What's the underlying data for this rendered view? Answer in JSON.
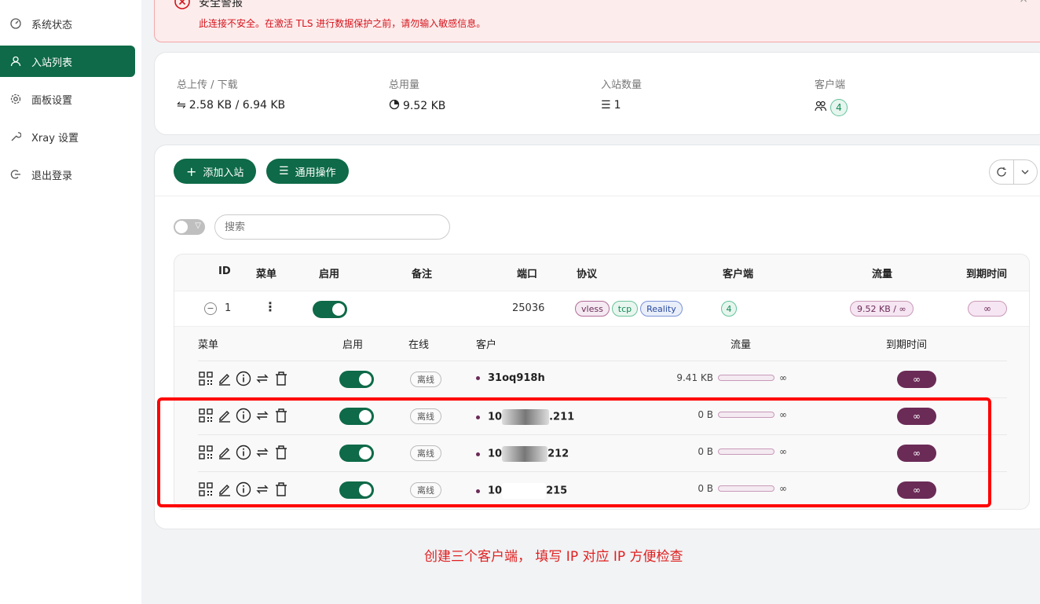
{
  "sidebar": {
    "items": [
      {
        "label": "系统状态",
        "icon": "dashboard-icon"
      },
      {
        "label": "入站列表",
        "icon": "user-icon",
        "active": true
      },
      {
        "label": "面板设置",
        "icon": "gear-icon"
      },
      {
        "label": "Xray 设置",
        "icon": "wrench-icon"
      },
      {
        "label": "退出登录",
        "icon": "logout-icon"
      }
    ]
  },
  "alert": {
    "title": "安全警报",
    "message": "此连接不安全。在激活 TLS 进行数据保护之前，请勿输入敏感信息。",
    "close": "×"
  },
  "stats": {
    "upload_download": {
      "label": "总上传 / 下载",
      "value": "2.58 KB / 6.94 KB",
      "symbol": "⇋"
    },
    "total_usage": {
      "label": "总用量",
      "value": "9.52 KB"
    },
    "inbound_count": {
      "label": "入站数量",
      "value": "1",
      "symbol": "☰"
    },
    "clients": {
      "label": "客户端",
      "value": "4"
    }
  },
  "toolbar": {
    "add_inbound": "添加入站",
    "general_actions": "通用操作",
    "search_placeholder": "搜索"
  },
  "table": {
    "headers": {
      "id": "ID",
      "menu": "菜单",
      "enabled": "启用",
      "remark": "备注",
      "port": "端口",
      "protocol": "协议",
      "clients": "客户端",
      "traffic": "流量",
      "expiry": "到期时间"
    },
    "inbound": {
      "collapse": "−",
      "id": "1",
      "menu": "⋮",
      "remark": "",
      "port": "25036",
      "protocols": [
        "vless",
        "tcp",
        "Reality"
      ],
      "clients": "4",
      "traffic": "9.52 KB / ∞",
      "expiry": "∞",
      "enabled": true
    }
  },
  "client_table": {
    "headers": {
      "menu": "菜单",
      "enabled": "启用",
      "online": "在线",
      "client": "客户",
      "traffic": "流量",
      "expiry": "到期时间"
    },
    "rows": [
      {
        "name_pre": "31oq918h",
        "name_post": "",
        "status": "离线",
        "traffic": "9.41 KB",
        "limit": "∞",
        "expiry": "∞",
        "enabled": true
      },
      {
        "name_pre": "10",
        "name_post": ".211",
        "status": "离线",
        "traffic": "0 B",
        "limit": "∞",
        "expiry": "∞",
        "enabled": true
      },
      {
        "name_pre": "10",
        "name_post": "212",
        "status": "离线",
        "traffic": "0 B",
        "limit": "∞",
        "expiry": "∞",
        "enabled": true
      },
      {
        "name_pre": "10",
        "name_post": "215",
        "status": "离线",
        "traffic": "0 B",
        "limit": "∞",
        "expiry": "∞",
        "enabled": true
      }
    ]
  },
  "annotation": {
    "text": "创建三个客户端， 填写 IP 对应 IP 方便检查",
    "color": "#e02020"
  },
  "colors": {
    "primary": "#0e6a48",
    "accent_purple": "#6b2b57",
    "alert_red": "#d4141c"
  }
}
